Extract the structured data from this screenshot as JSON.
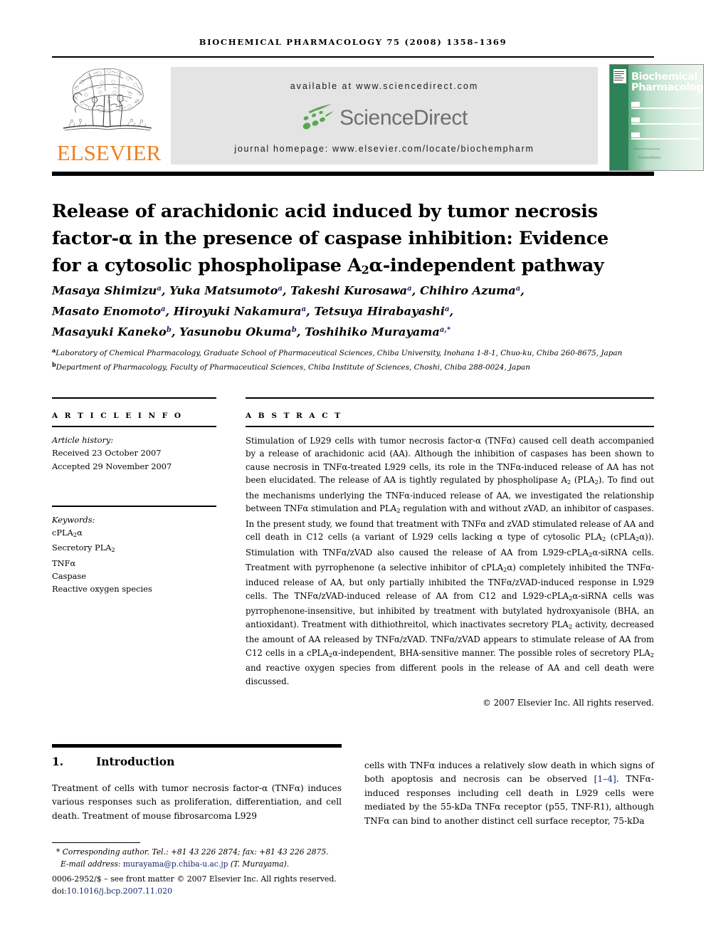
{
  "running_head": "BIOCHEMICAL PHARMACOLOGY 75 (2008) 1358–1369",
  "header": {
    "publisher_name": "ELSEVIER",
    "tree_logo_icon": "elsevier-tree-icon",
    "available_at": "available at www.sciencedirect.com",
    "sciencedirect_wordmark": "ScienceDirect",
    "sciencedirect_dots_icon": "sciencedirect-dots-icon",
    "journal_homepage": "journal homepage: www.elsevier.com/locate/biochempharm",
    "cover": {
      "title_line1": "Biochemical",
      "title_line2": "Pharmacology",
      "elsevier_mark_icon": "elsevier-box-icon",
      "footer_note": "Biochemical Pharmacology",
      "sciencedirect_note": "ScienceDirect"
    }
  },
  "article": {
    "title_line1": "Release of arachidonic acid induced by tumor necrosis",
    "title_line2_a": "factor-α in the presence of caspase inhibition: Evidence",
    "title_line3_a": "for a cytosolic phospholipase A",
    "title_line3_sub": "2",
    "title_line3_b": "α-independent pathway",
    "authors_line1": "Masaya Shimizu a, Yuka Matsumoto a, Takeshi Kurosawa a, Chihiro Azuma a,",
    "authors_line2": "Masato Enomoto a, Hiroyuki Nakamura a, Tetsuya Hirabayashi a,",
    "authors_line3": "Masayuki Kaneko b, Yasunobu Okuma b, Toshihiko Murayama a,*",
    "affiliation_a": "Laboratory of Chemical Pharmacology, Graduate School of Pharmaceutical Sciences, Chiba University, Inohana 1-8-1, Chuo-ku, Chiba 260-8675, Japan",
    "affiliation_b": "Department of Pharmacology, Faculty of Pharmaceutical Sciences, Chiba Institute of Sciences, Choshi, Chiba 288-0024, Japan"
  },
  "article_info": {
    "section_label": "A R T I C L E   I N F O",
    "history_label": "Article history:",
    "received": "Received 23 October 2007",
    "accepted": "Accepted 29 November 2007",
    "keywords_label": "Keywords:",
    "keywords": [
      "cPLA2α",
      "Secretory PLA2",
      "TNFα",
      "Caspase",
      "Reactive oxygen species"
    ]
  },
  "abstract": {
    "section_label": "A B S T R A C T",
    "text": "Stimulation of L929 cells with tumor necrosis factor-α (TNFα) caused cell death accompanied by a release of arachidonic acid (AA). Although the inhibition of caspases has been shown to cause necrosis in TNFα-treated L929 cells, its role in the TNFα-induced release of AA has not been elucidated. The release of AA is tightly regulated by phospholipase A2 (PLA2). To find out the mechanisms underlying the TNFα-induced release of AA, we investigated the relationship between TNFα stimulation and PLA2 regulation with and without zVAD, an inhibitor of caspases. In the present study, we found that treatment with TNFα and zVAD stimulated release of AA and cell death in C12 cells (a variant of L929 cells lacking α type of cytosolic PLA2 (cPLA2α)). Stimulation with TNFα/zVAD also caused the release of AA from L929-cPLA2α-siRNA cells. Treatment with pyrrophenone (a selective inhibitor of cPLA2α) completely inhibited the TNFα-induced release of AA, but only partially inhibited the TNFα/zVAD-induced response in L929 cells. The TNFα/zVAD-induced release of AA from C12 and L929-cPLA2α-siRNA cells was pyrrophenone-insensitive, but inhibited by treatment with butylated hydroxyanisole (BHA, an antioxidant). Treatment with dithiothreitol, which inactivates secretory PLA2 activity, decreased the amount of AA released by TNFα/zVAD. TNFα/zVAD appears to stimulate release of AA from C12 cells in a cPLA2α-independent, BHA-sensitive manner. The possible roles of secretory PLA2 and reactive oxygen species from different pools in the release of AA and cell death were discussed.",
    "copyright": "© 2007 Elsevier Inc. All rights reserved."
  },
  "introduction": {
    "number": "1.",
    "heading": "Introduction",
    "left_column": "Treatment of cells with tumor necrosis factor-α (TNFα) induces various responses such as proliferation, differentiation, and cell death. Treatment of mouse fibrosarcoma L929",
    "right_column_pre": "cells with TNFα induces a relatively slow death in which signs of both apoptosis and necrosis can be observed ",
    "right_column_citation": "[1–4]",
    "right_column_post": ". TNFα-induced responses including cell death in L929 cells were mediated by the 55-kDa TNFα receptor (p55, TNF-R1), although TNFα can bind to another distinct cell surface receptor, 75-kDa"
  },
  "footnotes": {
    "corresponding_marker": "*",
    "corresponding_text": "Corresponding author. Tel.: +81 43 226 2874; fax: +81 43 226 2875.",
    "email_label": "E-mail address:",
    "email": "murayama@p.chiba-u.ac.jp",
    "email_suffix": "(T. Murayama).",
    "front_matter": "0006-2952/$ – see front matter © 2007 Elsevier Inc. All rights reserved.",
    "doi_label": "doi:",
    "doi": "10.1016/j.bcp.2007.11.020"
  },
  "colors": {
    "elsevier_orange": "#F08020",
    "link_blue": "#14246e",
    "band_gray": "#e4e4e4",
    "cover_green": "#2e8257",
    "sciencedirect_gray": "#6d6f71",
    "sciencedirect_green": "#5aa84f"
  }
}
